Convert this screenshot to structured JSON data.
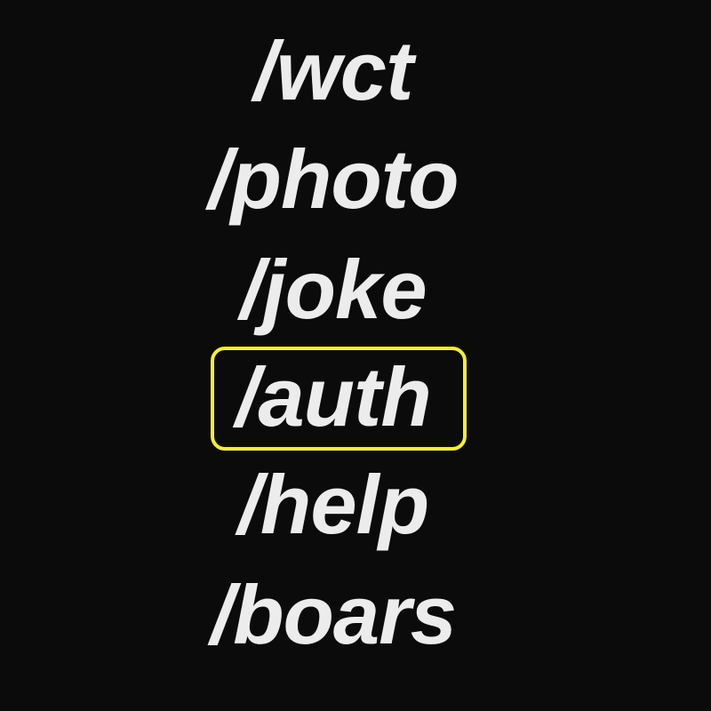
{
  "commands": [
    "/wct",
    "/photo",
    "/joke",
    "/auth",
    "/help",
    "/boars"
  ],
  "highlighted_index": 3,
  "colors": {
    "background": "#0b0b0b",
    "text": "#ececec",
    "highlight": "#f5ef2e"
  }
}
